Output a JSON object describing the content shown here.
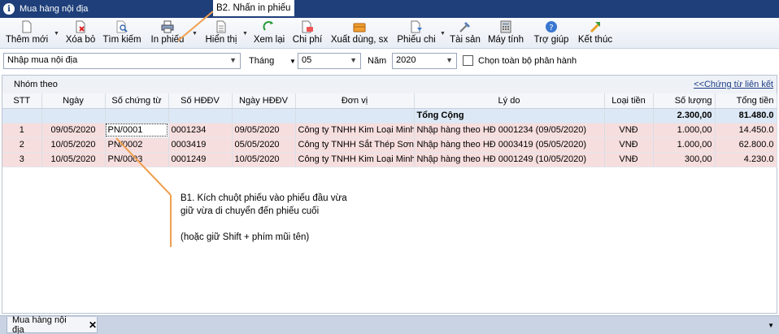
{
  "window": {
    "title": "Mua hàng nội địa"
  },
  "toolbar": {
    "them_moi": "Thêm mới",
    "xoa_bo": "Xóa bỏ",
    "tim_kiem": "Tìm kiếm",
    "in_phieu": "In phiếu",
    "hien_thi": "Hiển thị",
    "xem_lai": "Xem lại",
    "chi_phi": "Chi phí",
    "xuat_dung": "Xuất dùng, sx",
    "phieu_chi": "Phiếu chi",
    "tai_san": "Tài sản",
    "may_tinh": "Máy tính",
    "tro_giup": "Trợ giúp",
    "ket_thuc": "Kết thúc"
  },
  "filter": {
    "type_value": "Nhập mua nội địa",
    "thang_label": "Tháng",
    "thang_value": "05",
    "nam_label": "Năm",
    "nam_value": "2020",
    "chon_tat_ca": "Chọn toàn bộ phân hành"
  },
  "group": {
    "label": "Nhóm theo",
    "link": "<<Chứng từ liên kết"
  },
  "table": {
    "headers": [
      "STT",
      "Ngày",
      "Số chứng từ",
      "Số HĐĐV",
      "Ngày HĐĐV",
      "Đơn vị",
      "Lý do",
      "Loại tiền",
      "Số lượng",
      "Tổng tiền"
    ],
    "total": {
      "label": "Tổng Cộng",
      "so_luong": "2.300,00",
      "tong_tien": "81.480.0"
    },
    "rows": [
      {
        "stt": "1",
        "ngay": "09/05/2020",
        "so_ct": "PN/0001",
        "so_hd": "0001234",
        "ngay_hd": "09/05/2020",
        "don_vi": "Công ty TNHH Kim Loại Minh (",
        "ly_do": "Nhập hàng theo HĐ 0001234 (09/05/2020)",
        "loai_tien": "VNĐ",
        "so_luong": "1.000,00",
        "tong_tien": "14.450.0"
      },
      {
        "stt": "2",
        "ngay": "10/05/2020",
        "so_ct": "PN/0002",
        "so_hd": "0003419",
        "ngay_hd": "05/05/2020",
        "don_vi": "Công ty TNHH Sắt Thép Sơn I",
        "ly_do": "Nhập hàng theo HĐ 0003419 (05/05/2020)",
        "loai_tien": "VNĐ",
        "so_luong": "1.000,00",
        "tong_tien": "62.800.0"
      },
      {
        "stt": "3",
        "ngay": "10/05/2020",
        "so_ct": "PN/0003",
        "so_hd": "0001249",
        "ngay_hd": "10/05/2020",
        "don_vi": "Công ty TNHH Kim Loại Minh (",
        "ly_do": "Nhập hàng theo HĐ 0001249 (10/05/2020)",
        "loai_tien": "VNĐ",
        "so_luong": "300,00",
        "tong_tien": "4.230.0"
      }
    ]
  },
  "annotations": {
    "b2": "B2. Nhấn in phiếu",
    "b1_line1": "B1. Kích chuột phiếu vào phiếu đầu vừa",
    "b1_line2": "giữ vừa di chuyển đến phiếu cuối",
    "b1_line3": "(hoặc giữ Shift + phím mũi tên)",
    "color": "#f0a050"
  },
  "bottom_tab": {
    "label": "Mua hàng nội địa"
  }
}
